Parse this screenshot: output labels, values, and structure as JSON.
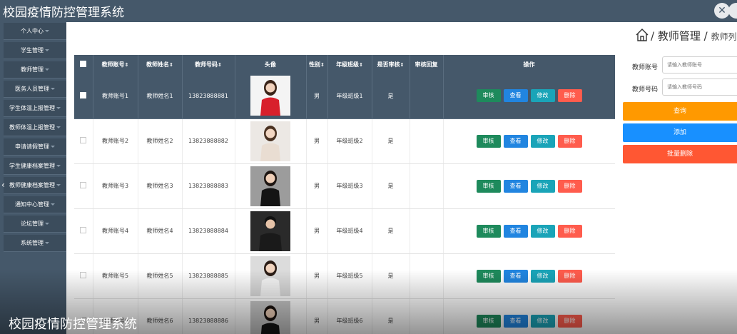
{
  "app": {
    "title": "校园疫情防控管理系统"
  },
  "sidebar": {
    "items": [
      {
        "label": "个人中心"
      },
      {
        "label": "学生管理"
      },
      {
        "label": "教师管理"
      },
      {
        "label": "医务人员管理"
      },
      {
        "label": "学生体温上报管理"
      },
      {
        "label": "教师体温上报管理"
      },
      {
        "label": "申请请假管理"
      },
      {
        "label": "学生健康档案管理"
      },
      {
        "label": "教师健康档案管理"
      },
      {
        "label": "通知中心管理"
      },
      {
        "label": "论坛管理"
      },
      {
        "label": "系统管理"
      }
    ]
  },
  "breadcrumb": {
    "sep": "/",
    "parent": "教师管理",
    "current": "教师列"
  },
  "table": {
    "headers": {
      "account": "教师账号",
      "name": "教师姓名",
      "phone": "教师号码",
      "avatar": "头像",
      "gender": "性别",
      "class": "年级班级",
      "audited": "是否审核",
      "reply": "审核回复",
      "ops": "操作"
    },
    "sort_glyph": "⇕",
    "rows": [
      {
        "account": "教师账号1",
        "name": "教师姓名1",
        "phone": "13823888881",
        "gender": "男",
        "class": "年级班级1",
        "audited": "是",
        "reply": ""
      },
      {
        "account": "教师账号2",
        "name": "教师姓名2",
        "phone": "13823888882",
        "gender": "男",
        "class": "年级班级2",
        "audited": "是",
        "reply": ""
      },
      {
        "account": "教师账号3",
        "name": "教师姓名3",
        "phone": "13823888883",
        "gender": "男",
        "class": "年级班级3",
        "audited": "是",
        "reply": ""
      },
      {
        "account": "教师账号4",
        "name": "教师姓名4",
        "phone": "13823888884",
        "gender": "男",
        "class": "年级班级4",
        "audited": "是",
        "reply": ""
      },
      {
        "account": "教师账号5",
        "name": "教师姓名5",
        "phone": "13823888885",
        "gender": "男",
        "class": "年级班级5",
        "audited": "是",
        "reply": ""
      },
      {
        "account": "教师账号6",
        "name": "教师姓名6",
        "phone": "13823888886",
        "gender": "男",
        "class": "年级班级6",
        "audited": "是",
        "reply": ""
      }
    ],
    "actions": {
      "audit": "审核",
      "view": "查看",
      "edit": "修改",
      "delete": "删除"
    }
  },
  "search": {
    "account_label": "教师账号",
    "account_placeholder": "请输入教师账号",
    "phone_label": "教师号码",
    "phone_placeholder": "请输入教师号码",
    "query_button": "查询",
    "add_button": "添加",
    "batch_delete_button": "批量删除"
  },
  "caption": "校园疫情防控管理系统",
  "colors": {
    "primary": "#45586a",
    "audit": "#1e8a5c",
    "view": "#2185e0",
    "edit": "#1aa4b8",
    "delete": "#ff5c4d",
    "query": "#ff9900",
    "add": "#1890ff",
    "batch_delete": "#ff5733"
  }
}
